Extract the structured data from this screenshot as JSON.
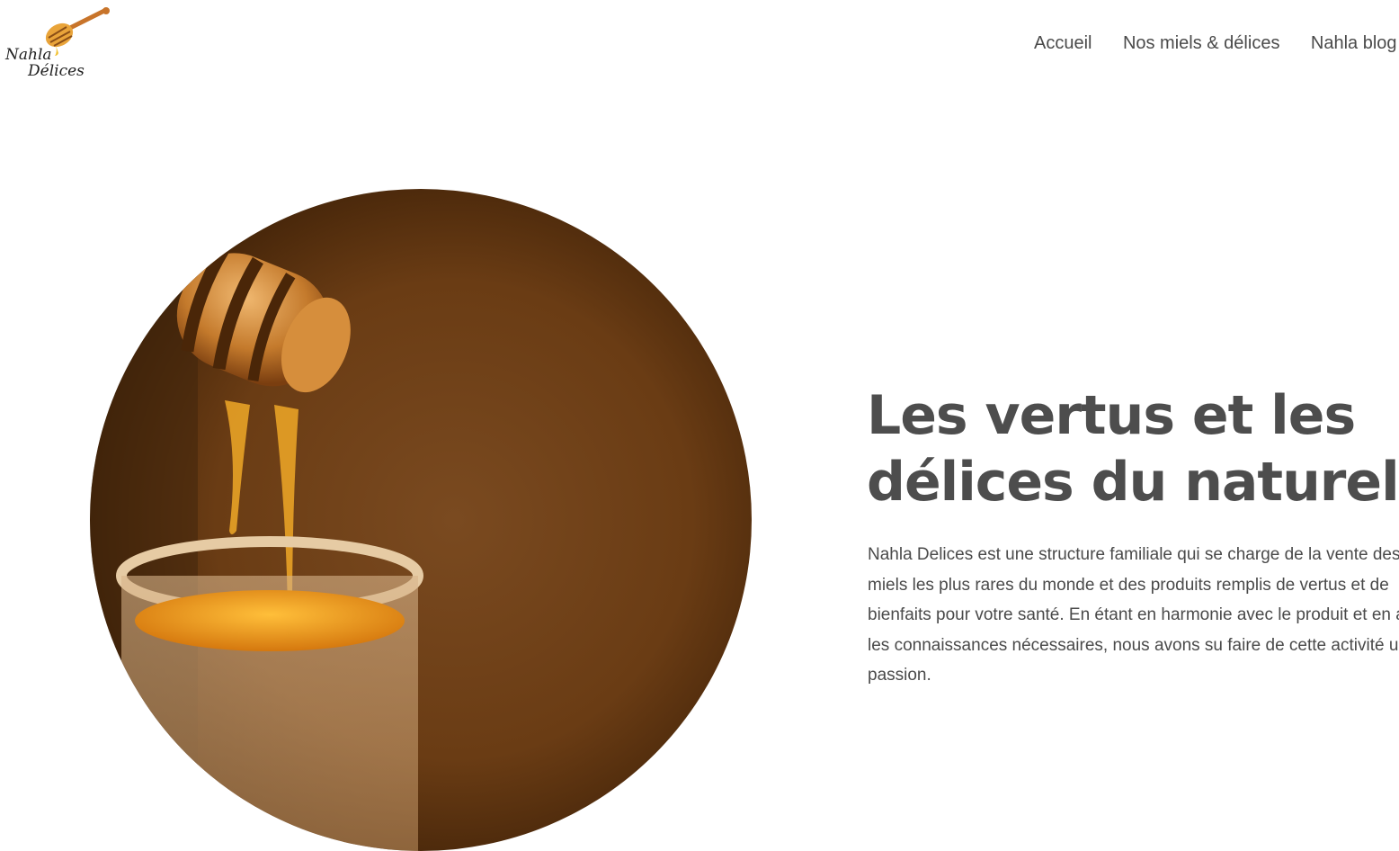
{
  "brand": {
    "name_line1": "Nahla",
    "name_line2": "Délices",
    "icon": "honey-dipper-icon"
  },
  "nav": {
    "items": [
      "Accueil",
      "Nos miels & délices",
      "Nahla blog"
    ]
  },
  "hero": {
    "image": "honey-dipper-photo",
    "title_line1": "Les vertus et les",
    "title_line2": "délices du naturel",
    "description": "Nahla Delices est une structure familiale qui se charge de la vente des miels les plus rares du monde et des produits remplis de vertus et de bienfaits pour votre santé. En étant en harmonie avec le produit et en ayant les connaissances nécessaires, nous avons su faire de cette activité une passion."
  },
  "colors": {
    "honey": "#e59a2f",
    "dark_brown": "#5a3a15",
    "text": "#4a4a4a"
  }
}
